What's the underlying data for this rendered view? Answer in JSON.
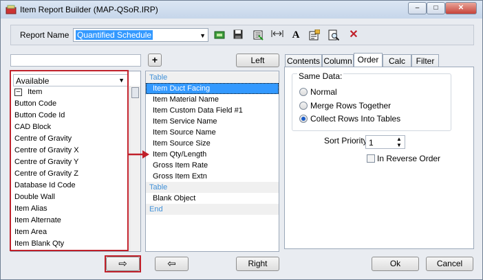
{
  "window": {
    "title": "Item Report Builder (MAP-QSoR.IRP)",
    "controls": {
      "minimize": "–",
      "maximize": "□",
      "close": "✕"
    }
  },
  "toolbar": {
    "report_name_label": "Report Name",
    "report_name_value": "Quantified Schedule",
    "icons": [
      "open-report-icon",
      "save-icon",
      "insert-field-icon",
      "column-width-icon",
      "font-icon",
      "properties-icon",
      "preview-icon",
      "delete-icon"
    ]
  },
  "available_panel": {
    "filter_value": "",
    "add_button": "+",
    "dropdown_value": "Available",
    "group_header": "Item",
    "items": [
      "Button Code",
      "Button Code Id",
      "CAD Block",
      "Centre of Gravity",
      "Centre of Gravity X",
      "Centre of Gravity Y",
      "Centre of Gravity Z",
      "Database Id Code",
      "Double Wall",
      "Item Alias",
      "Item Alternate",
      "Item Area",
      "Item Blank Qty"
    ]
  },
  "middle_panel": {
    "left_button": "Left",
    "right_button": "Right",
    "rows": [
      {
        "text": "Table",
        "kind": "section"
      },
      {
        "text": "Item Duct Facing",
        "kind": "selected"
      },
      {
        "text": "Item Material Name",
        "kind": "item"
      },
      {
        "text": "Item Custom Data Field #1",
        "kind": "item"
      },
      {
        "text": "Item Service Name",
        "kind": "item"
      },
      {
        "text": "Item Source Name",
        "kind": "item"
      },
      {
        "text": "Item Source Size",
        "kind": "item"
      },
      {
        "text": "Item Qty/Length",
        "kind": "item"
      },
      {
        "text": "Gross Item Rate",
        "kind": "item"
      },
      {
        "text": "Gross Item Extn",
        "kind": "item"
      },
      {
        "text": "Table",
        "kind": "section"
      },
      {
        "text": "Blank Object",
        "kind": "item"
      },
      {
        "text": "End",
        "kind": "section"
      }
    ]
  },
  "move_buttons": {
    "add": "⇨",
    "remove": "⇦"
  },
  "tabs": [
    "Contents",
    "Column",
    "Order",
    "Calc",
    "Filter"
  ],
  "active_tab": "Order",
  "order_tab": {
    "group_label": "Same Data:",
    "options": [
      {
        "label": "Normal",
        "selected": false
      },
      {
        "label": "Merge Rows Together",
        "selected": false
      },
      {
        "label": "Collect Rows Into Tables",
        "selected": true
      }
    ],
    "sort_priority_label": "Sort Priority",
    "sort_priority_value": "1",
    "reverse_label": "In Reverse Order",
    "reverse_checked": false
  },
  "footer": {
    "ok": "Ok",
    "cancel": "Cancel"
  },
  "colors": {
    "highlight": "#c0202a",
    "selection": "#3399ff",
    "section_text": "#4090d8"
  }
}
